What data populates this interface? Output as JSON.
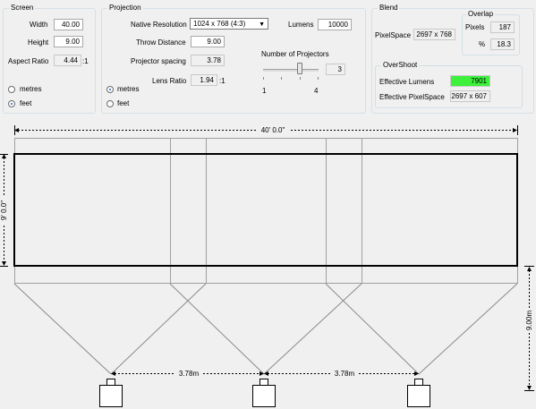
{
  "screen": {
    "title": "Screen",
    "width_label": "Width",
    "width_value": "40.00",
    "height_label": "Height",
    "height_value": "9.00",
    "aspect_label": "Aspect Ratio",
    "aspect_value": "4.44",
    "aspect_suffix": ":1",
    "units": {
      "metres_label": "metres",
      "feet_label": "feet",
      "selected": "feet"
    }
  },
  "projection": {
    "title": "Projection",
    "native_res_label": "Native Resolution",
    "native_res_value": "1024 x 768 (4:3)",
    "lumens_label": "Lumens",
    "lumens_value": "10000",
    "throw_label": "Throw Distance",
    "throw_value": "9.00",
    "spacing_label": "Projector spacing",
    "spacing_value": "3.78",
    "lens_label": "Lens Ratio",
    "lens_value": "1.94",
    "lens_suffix": ":1",
    "num_proj_label": "Number of Projectors",
    "num_proj_value": "3",
    "slider_min": "1",
    "slider_max": "4",
    "slider_level_fraction": 0.667,
    "units": {
      "metres_label": "metres",
      "feet_label": "feet",
      "selected": "metres"
    }
  },
  "blend": {
    "title": "Blend",
    "pixelspace_label": "PixelSpace",
    "pixelspace_value": "2697 x 768",
    "overlap": {
      "title": "Overlap",
      "pixels_label": "Pixels",
      "pixels_value": "187",
      "percent_label": "%",
      "percent_value": "18.3"
    },
    "overshoot": {
      "title": "OverShoot",
      "eff_lumens_label": "Effective Lumens",
      "eff_lumens_value": "7901",
      "eff_pixelspace_label": "Effective PixelSpace",
      "eff_pixelspace_value": "2697 x 607"
    },
    "highlight_color": "#3cf03c"
  },
  "diagram": {
    "screen_width_label": "40' 0.0\"",
    "screen_height_label": "9' 0.0\"",
    "throw_label": "9.00m",
    "spacing_labels": [
      "3.78m",
      "3.78m"
    ],
    "projector_count": 3
  }
}
